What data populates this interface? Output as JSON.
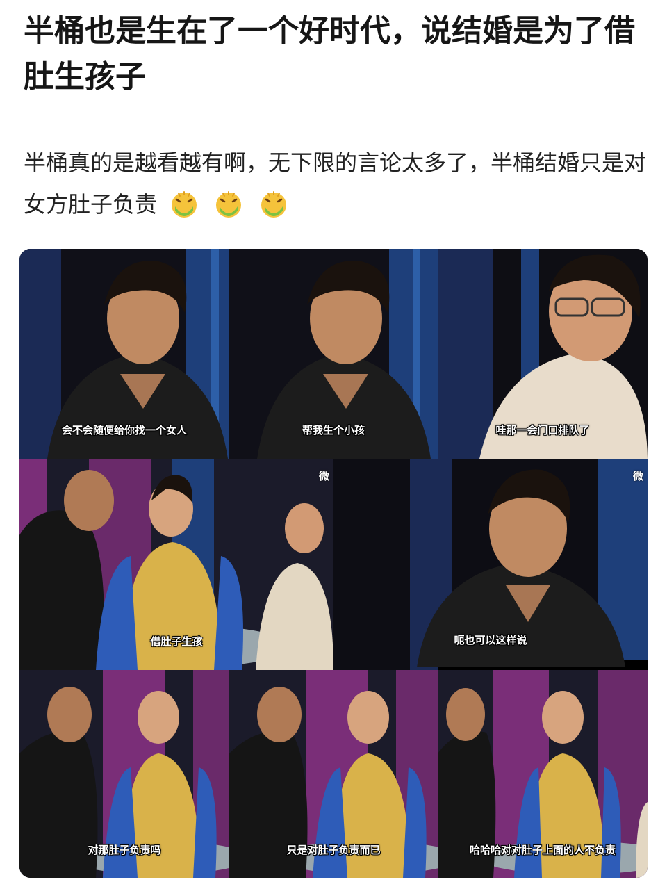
{
  "post": {
    "title": "半桶也是生在了一个好时代，说结婚是为了借肚生孩子",
    "body": "半桶真的是越看越有啊，无下限的言论太多了，半桶结婚只是对女方肚子负责",
    "emojis": [
      "vomit-face-icon",
      "vomit-face-icon",
      "vomit-face-icon"
    ]
  },
  "panels": [
    {
      "caption": "会不会随便给你找一个女人"
    },
    {
      "caption": "帮我生个小孩"
    },
    {
      "caption": "哇那一会门口排队了"
    },
    {
      "caption": "借肚子生孩"
    },
    {
      "caption": "呃也可以这样说"
    },
    {
      "caption": "对那肚子负责吗"
    },
    {
      "caption": "只是对肚子负责而已"
    },
    {
      "caption": "哈哈哈对对肚子上面的人不负责"
    }
  ],
  "watermark": "微",
  "colors": {
    "stage_blue": "#1e3f7a",
    "curtain_purple": "#7a2e78",
    "vest_yellow": "#d9b24a",
    "emoji_green": "#7dc242",
    "emoji_yellow": "#f5c33b"
  }
}
